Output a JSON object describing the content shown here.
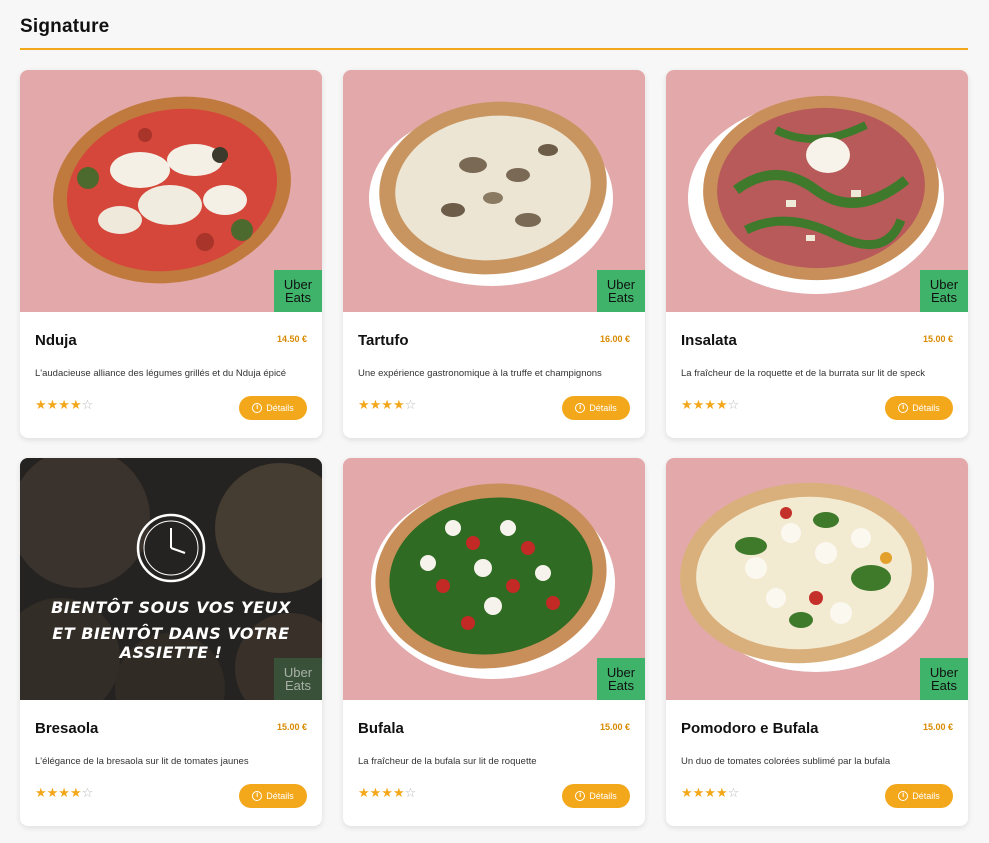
{
  "section": {
    "title": "Signature"
  },
  "colors": {
    "accent": "#f3a71b",
    "uber": "#3fb36a",
    "card_bg": "#ffffff",
    "photo_bg": "#e3a8aa"
  },
  "uber_badge": {
    "line1": "Uber",
    "line2": "Eats"
  },
  "items": [
    {
      "name": "Nduja",
      "price": "14.50 €",
      "description": "L'audacieuse alliance des légumes grillés et du Nduja épicé",
      "rating": 4,
      "rating_max": 5,
      "button": "Détails",
      "icon": "pizza-nduja-photo"
    },
    {
      "name": "Tartufo",
      "price": "16.00 €",
      "description": "Une expérience gastronomique à la truffe et champignons",
      "rating": 4,
      "rating_max": 5,
      "button": "Détails",
      "icon": "pizza-tartufo-photo"
    },
    {
      "name": "Insalata",
      "price": "15.00 €",
      "description": "La fraîcheur de la roquette et de la burrata sur lit de speck",
      "rating": 4,
      "rating_max": 5,
      "button": "Détails",
      "icon": "pizza-insalata-photo"
    },
    {
      "name": "Bresaola",
      "price": "15.00 €",
      "description": "L'élégance de la bresaola sur lit de tomates jaunes",
      "rating": 4,
      "rating_max": 5,
      "button": "Détails",
      "icon": "coming-soon-photo",
      "overlay": {
        "line1": "BIENTÔT SOUS VOS YEUX",
        "line2": "ET BIENTÔT DANS VOTRE ASSIETTE !"
      }
    },
    {
      "name": "Bufala",
      "price": "15.00 €",
      "description": "La fraîcheur de la bufala sur lit de roquette",
      "rating": 4,
      "rating_max": 5,
      "button": "Détails",
      "icon": "pizza-bufala-photo"
    },
    {
      "name": "Pomodoro e Bufala",
      "price": "15.00 €",
      "description": "Un duo de tomates colorées sublimé par la bufala",
      "rating": 4,
      "rating_max": 5,
      "button": "Détails",
      "icon": "pizza-pomodoro-photo"
    }
  ]
}
